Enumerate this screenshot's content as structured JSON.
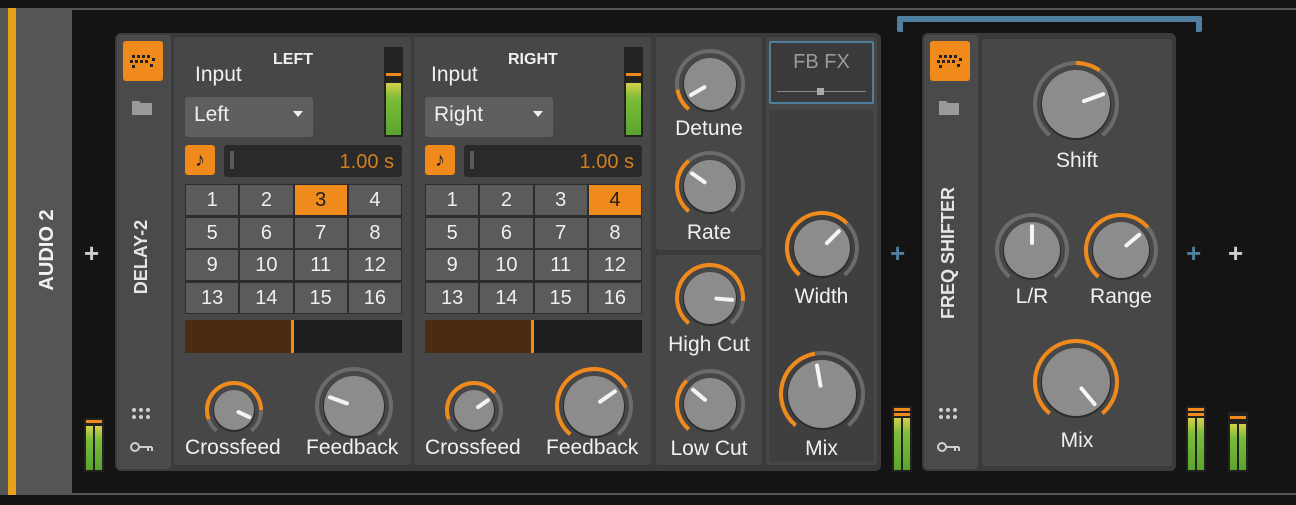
{
  "track": {
    "name": "AUDIO 2"
  },
  "delay": {
    "name": "DELAY-2",
    "left": {
      "title": "LEFT",
      "input_label": "Input",
      "input_value": "Left",
      "time": "1.00 s",
      "steps": [
        "1",
        "2",
        "3",
        "4",
        "5",
        "6",
        "7",
        "8",
        "9",
        "10",
        "11",
        "12",
        "13",
        "14",
        "15",
        "16"
      ],
      "active_step": "3",
      "crossfeed": "Crossfeed",
      "feedback": "Feedback"
    },
    "right": {
      "title": "RIGHT",
      "input_label": "Input",
      "input_value": "Right",
      "time": "1.00 s",
      "steps": [
        "1",
        "2",
        "3",
        "4",
        "5",
        "6",
        "7",
        "8",
        "9",
        "10",
        "11",
        "12",
        "13",
        "14",
        "15",
        "16"
      ],
      "active_step": "4",
      "crossfeed": "Crossfeed",
      "feedback": "Feedback"
    },
    "mod": {
      "detune": "Detune",
      "rate": "Rate"
    },
    "filter": {
      "high_cut": "High Cut",
      "low_cut": "Low Cut"
    },
    "fb_fx": "FB FX",
    "width": "Width",
    "mix": "Mix"
  },
  "freq_shifter": {
    "name": "FREQ SHIFTER",
    "shift": "Shift",
    "lr": "L/R",
    "range": "Range",
    "mix": "Mix"
  },
  "icons": {
    "device": "device-icon",
    "folder": "folder-icon",
    "modulators": "modulator-dots-icon",
    "routing": "routing-key-icon",
    "note": "note-sync-icon"
  },
  "colors": {
    "accent": "#f08a1c",
    "blue": "#4f7e9e",
    "track": "#e5a21a"
  }
}
